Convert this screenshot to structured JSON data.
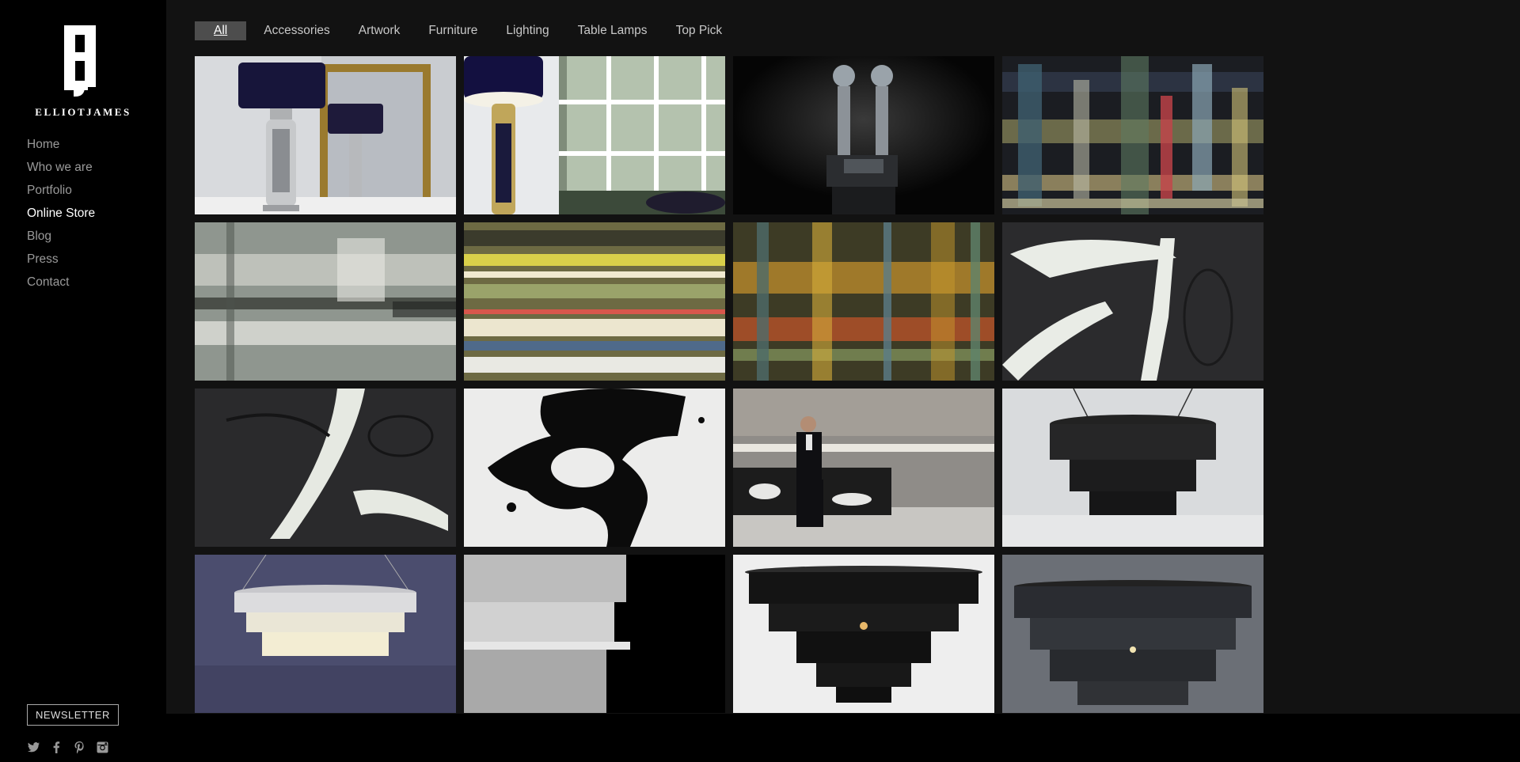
{
  "brand": {
    "logo_text": "ELLIOTJAMES",
    "logo_mark": "EJ"
  },
  "nav": {
    "items": [
      {
        "label": "Home",
        "active": false
      },
      {
        "label": "Who we are",
        "active": false
      },
      {
        "label": "Portfolio",
        "active": false
      },
      {
        "label": "Online Store",
        "active": true
      },
      {
        "label": "Blog",
        "active": false
      },
      {
        "label": "Press",
        "active": false
      },
      {
        "label": "Contact",
        "active": false
      }
    ]
  },
  "newsletter_label": "NEWSLETTER",
  "social_icons": [
    "twitter-icon",
    "facebook-icon",
    "pinterest-icon",
    "instagram-icon"
  ],
  "filters": [
    {
      "label": "All",
      "active": true
    },
    {
      "label": "Accessories",
      "active": false
    },
    {
      "label": "Artwork",
      "active": false
    },
    {
      "label": "Furniture",
      "active": false
    },
    {
      "label": "Lighting",
      "active": false
    },
    {
      "label": "Table Lamps",
      "active": false
    },
    {
      "label": "Top Pick",
      "active": false
    }
  ],
  "colors": {
    "sidebar_bg": "#000000",
    "main_bg": "#121212",
    "active_filter_bg": "#4d4d4d",
    "nav_text": "#9a9a9a",
    "nav_active": "#ffffff"
  },
  "products": [
    {
      "image": "table-lamp-mirror"
    },
    {
      "image": "table-lamp-window"
    },
    {
      "image": "twin-lamp-sculpture"
    },
    {
      "image": "abstract-blur-artwork"
    },
    {
      "image": "grey-streak-artwork"
    },
    {
      "image": "yellow-stripe-artwork"
    },
    {
      "image": "plaid-artwork"
    },
    {
      "image": "white-brush-artwork"
    },
    {
      "image": "dark-brush-artwork"
    },
    {
      "image": "black-splash-artwork"
    },
    {
      "image": "man-on-cowhide-bench"
    },
    {
      "image": "dark-fringe-chandelier"
    },
    {
      "image": "silver-fringe-chandelier"
    },
    {
      "image": "silver-chain-chandelier"
    },
    {
      "image": "black-crystal-chandelier"
    },
    {
      "image": "smoke-crystal-chandelier"
    }
  ]
}
